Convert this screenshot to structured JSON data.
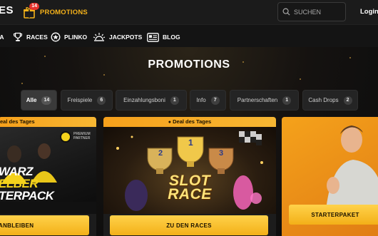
{
  "header": {
    "brand_fragment": "ES",
    "promotions_label": "PROMOTIONS",
    "promotions_badge": "14",
    "search_placeholder": "SUCHEN",
    "login_label": "Login"
  },
  "nav": {
    "items": [
      {
        "label": "IA",
        "icon": "partial-icon"
      },
      {
        "label": "RACES",
        "icon": "trophy-icon"
      },
      {
        "label": "PLINKO",
        "icon": "star-circle-icon"
      },
      {
        "label": "JACKPOTS",
        "icon": "jackpot-burst-icon"
      },
      {
        "label": "BLOG",
        "icon": "blog-card-icon"
      }
    ]
  },
  "page": {
    "title": "PROMOTIONS"
  },
  "filters": [
    {
      "label": "Alle",
      "count": "14",
      "active": true
    },
    {
      "label": "Freispiele",
      "count": "6",
      "active": false
    },
    {
      "label": "Einzahlungsboni",
      "count": "1",
      "active": false
    },
    {
      "label": "Info",
      "count": "7",
      "active": false
    },
    {
      "label": "Partnerschaften",
      "count": "1",
      "active": false
    },
    {
      "label": "Cash Drops",
      "count": "2",
      "active": false
    }
  ],
  "cards": [
    {
      "header": "eal des Tages",
      "art_lines": [
        "WARZ",
        "ELBER",
        "TERPACK"
      ],
      "partner_text": [
        "PREMIUM",
        "PARTNER"
      ],
      "cta": "ANBLEIBEN"
    },
    {
      "header": "Deal des Tages",
      "art_lines": [
        "SLOT",
        "RACE"
      ],
      "podium": [
        "2",
        "1",
        "3"
      ],
      "cta": "ZU DEN RACES"
    },
    {
      "header": "",
      "cta": "STARTERPAKET"
    }
  ],
  "colors": {
    "accent": "#f5b21a",
    "badge": "#e5322d",
    "cta_top": "#ffd24a",
    "cta_bottom": "#f3b018"
  }
}
